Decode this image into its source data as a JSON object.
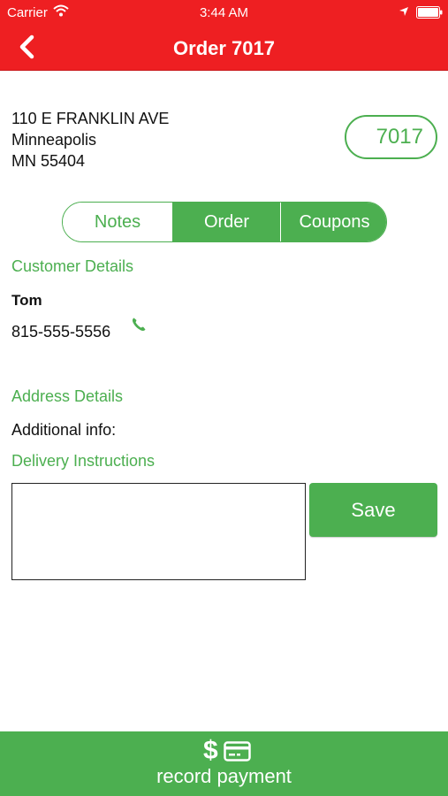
{
  "status_bar": {
    "carrier": "Carrier",
    "time": "3:44 AM"
  },
  "nav": {
    "title": "Order 7017",
    "back_icon": "chevron-left-icon"
  },
  "address": {
    "line1": "110 E FRANKLIN AVE",
    "line2": "Minneapolis",
    "line3": "MN 55404"
  },
  "order_badge": "7017",
  "tabs": [
    {
      "label": "Notes",
      "selected": false
    },
    {
      "label": "Order",
      "selected": true
    },
    {
      "label": "Coupons",
      "selected": false
    }
  ],
  "customer": {
    "section_label": "Customer Details",
    "name": "Tom",
    "phone": "815-555-5556",
    "phone_icon": "phone-icon"
  },
  "address_details": {
    "section_label": "Address Details",
    "additional_info_label": "Additional info:"
  },
  "delivery": {
    "section_label": "Delivery Instructions",
    "value": "",
    "save_label": "Save"
  },
  "footer": {
    "label": "record payment",
    "icons": [
      "dollar-icon",
      "credit-card-icon"
    ]
  },
  "colors": {
    "header": "#ee1f22",
    "accent": "#4caf50",
    "text": "#111111",
    "background": "#ffffff"
  }
}
